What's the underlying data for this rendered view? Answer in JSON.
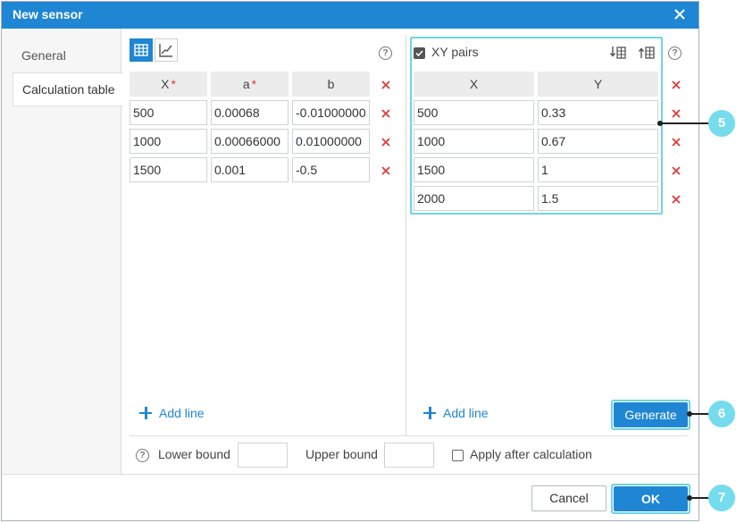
{
  "dialog": {
    "title": "New sensor"
  },
  "tabs": [
    {
      "label": "General",
      "active": false
    },
    {
      "label": "Calculation table",
      "active": true
    }
  ],
  "left_table": {
    "headers": [
      {
        "label": "X",
        "required": "*"
      },
      {
        "label": "a",
        "required": "*"
      },
      {
        "label": "b",
        "required": ""
      }
    ],
    "rows": [
      [
        "500",
        "0.00068",
        "-0.01000000"
      ],
      [
        "1000",
        "0.00066000",
        "0.01000000"
      ],
      [
        "1500",
        "0.001",
        "-0.5"
      ]
    ],
    "add_line_label": "Add line"
  },
  "right_table": {
    "xy_pairs_label": "XY pairs",
    "xy_pairs_checked": true,
    "headers": [
      "X",
      "Y"
    ],
    "rows": [
      [
        "500",
        "0.33"
      ],
      [
        "1000",
        "0.67"
      ],
      [
        "1500",
        "1"
      ],
      [
        "2000",
        "1.5"
      ]
    ],
    "add_line_label": "Add line",
    "generate_label": "Generate"
  },
  "bounds": {
    "lower_label": "Lower bound",
    "lower_value": "",
    "upper_label": "Upper bound",
    "upper_value": "",
    "apply_after_label": "Apply after calculation",
    "apply_after_checked": false
  },
  "footer": {
    "cancel_label": "Cancel",
    "ok_label": "OK"
  },
  "callouts": [
    "5",
    "6",
    "7"
  ],
  "colors": {
    "accent": "#1f86d4",
    "highlight": "#6fd4e4",
    "callout": "#75dced",
    "delete": "#e03a3a"
  }
}
